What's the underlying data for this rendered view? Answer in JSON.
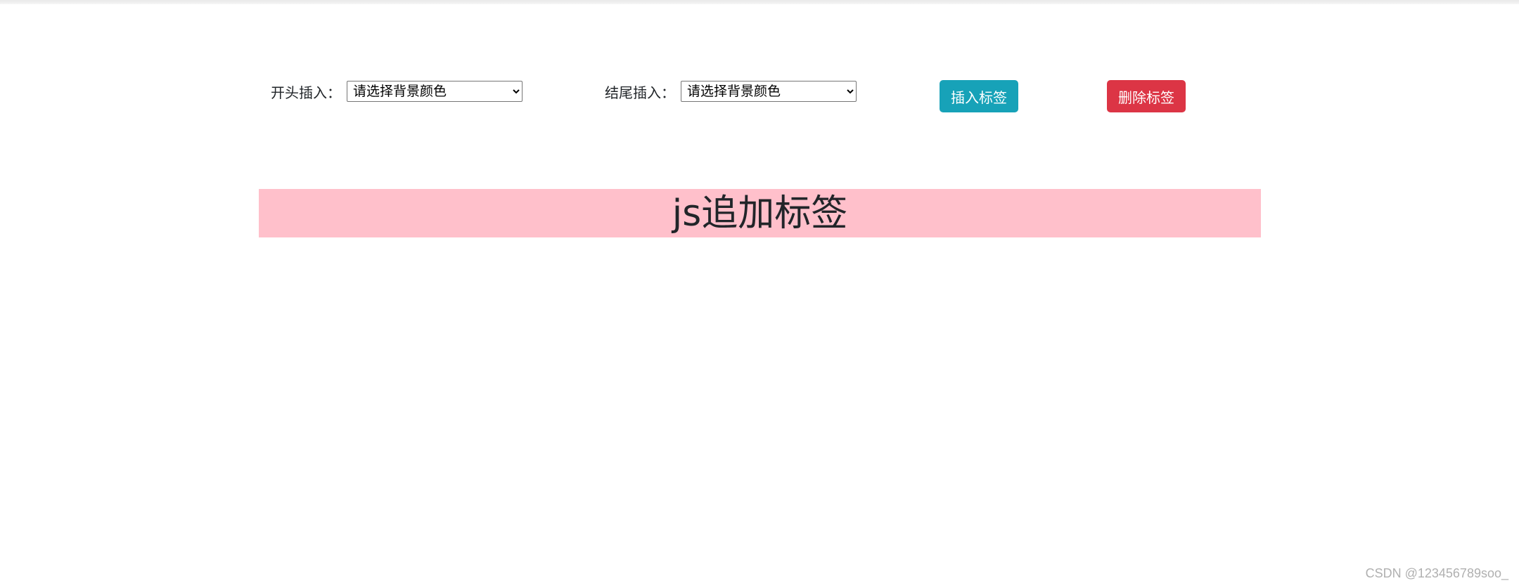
{
  "controls": {
    "start_insert": {
      "label": "开头插入：",
      "selected": "请选择背景颜色"
    },
    "end_insert": {
      "label": "结尾插入：",
      "selected": "请选择背景颜色"
    }
  },
  "buttons": {
    "insert_label": "插入标签",
    "delete_label": "删除标签"
  },
  "banner": {
    "text": "js追加标签",
    "background": "#ffc0cb"
  },
  "colors": {
    "insert_button": "#17a2b8",
    "delete_button": "#dc3545"
  },
  "watermark": "CSDN @123456789soo_"
}
